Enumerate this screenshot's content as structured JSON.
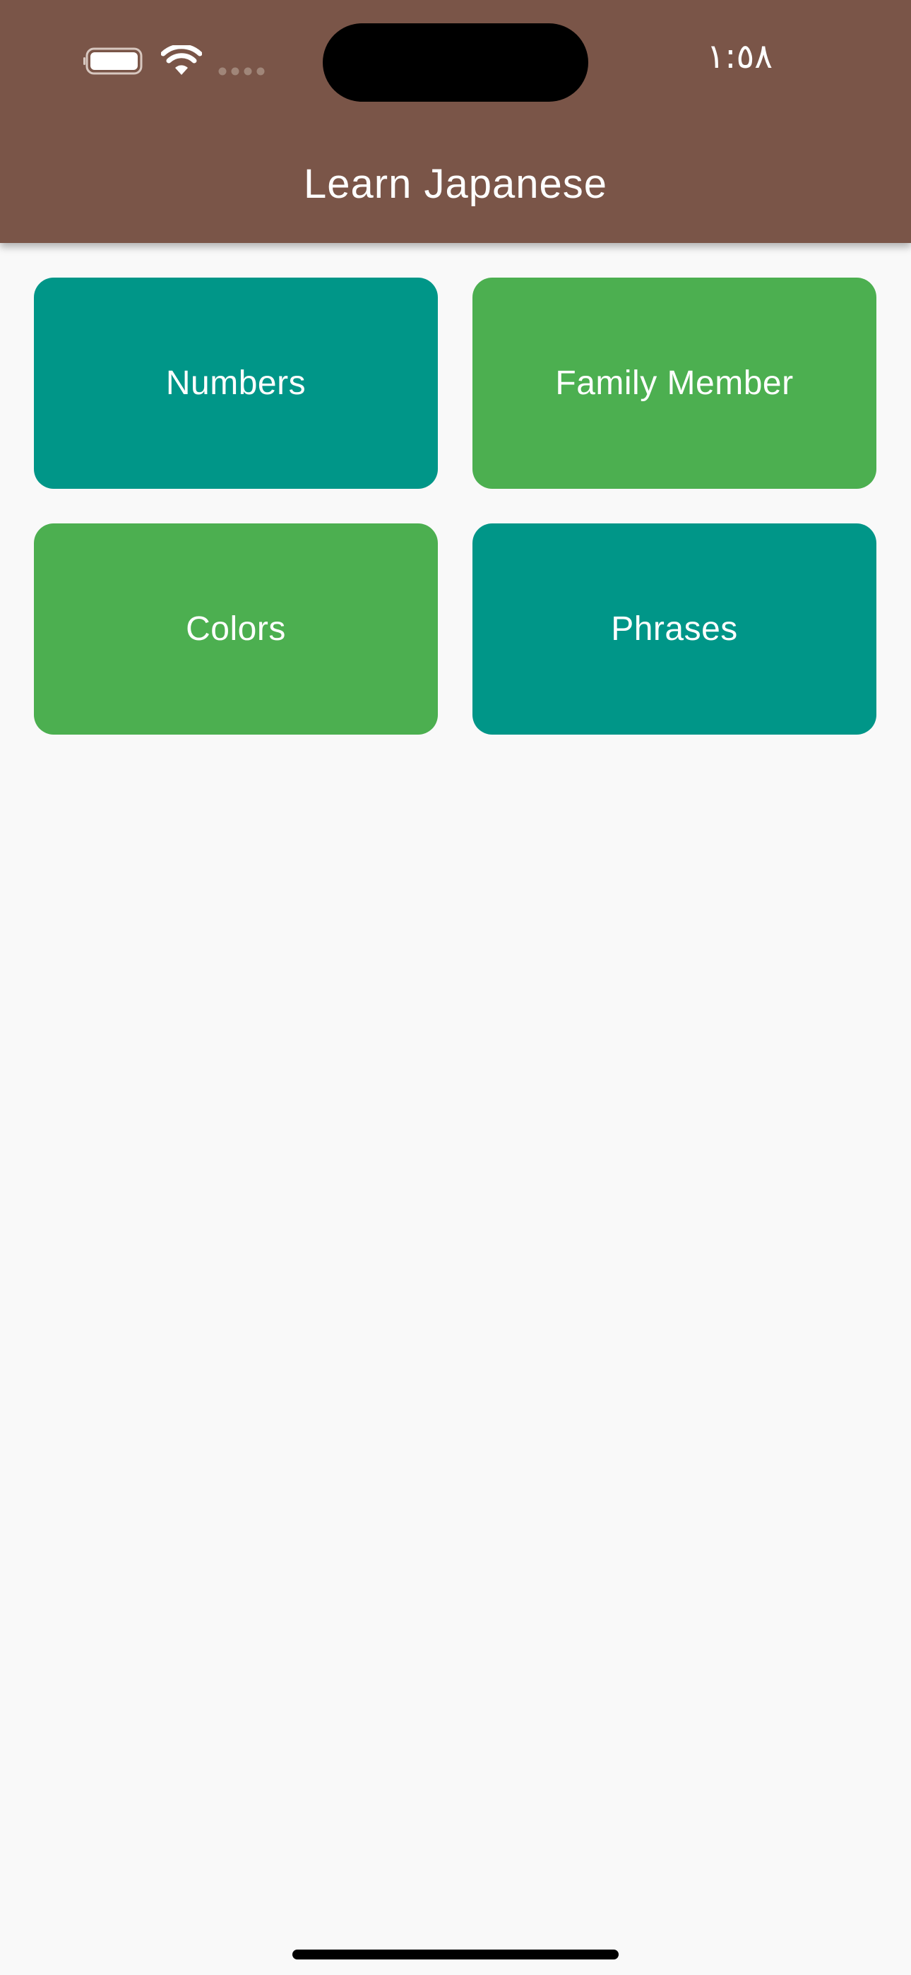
{
  "status_bar": {
    "time": "١:٥٨",
    "icons": [
      "battery-icon",
      "wifi-icon",
      "cellular-signal-icon"
    ]
  },
  "app_bar": {
    "title": "Learn Japanese",
    "color": "#7a5548"
  },
  "categories": [
    {
      "label": "Numbers",
      "color": "#009688"
    },
    {
      "label": "Family Member",
      "color": "#4caf50"
    },
    {
      "label": "Colors",
      "color": "#4caf50"
    },
    {
      "label": "Phrases",
      "color": "#009688"
    }
  ]
}
